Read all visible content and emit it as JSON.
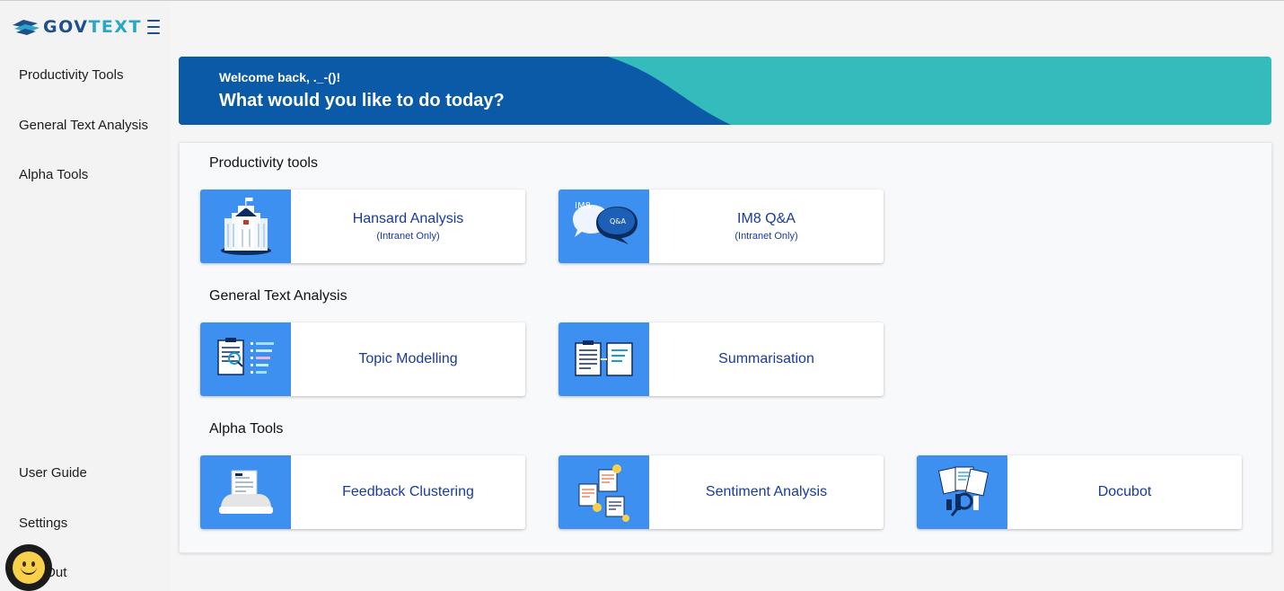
{
  "brand": {
    "gov": "GOV",
    "text": "TEXT"
  },
  "sidebar": {
    "top_items": [
      "Productivity Tools",
      "General Text Analysis",
      "Alpha Tools"
    ],
    "bottom_items": [
      "User Guide",
      "Settings",
      "Log Out"
    ]
  },
  "banner": {
    "welcome": "Welcome back, ._-()!",
    "question": "What would you like to do today?",
    "colors": {
      "left": "#0a5aa7",
      "right": "#34bcbd"
    }
  },
  "sections": [
    {
      "title": "Productivity tools",
      "cards": [
        {
          "title": "Hansard Analysis",
          "sub": "(Intranet Only)",
          "icon": "parliament-building-icon"
        },
        {
          "title": "IM8 Q&A",
          "sub": "(Intranet Only)",
          "icon": "chat-bubbles-icon",
          "icon_text_1": "IM8",
          "icon_text_2": "Q&A"
        }
      ]
    },
    {
      "title": "General Text Analysis",
      "cards": [
        {
          "title": "Topic Modelling",
          "icon": "document-topics-icon"
        },
        {
          "title": "Summarisation",
          "icon": "document-summary-icon"
        }
      ]
    },
    {
      "title": "Alpha Tools",
      "cards": [
        {
          "title": "Feedback Clustering",
          "icon": "feedback-printer-icon"
        },
        {
          "title": "Sentiment Analysis",
          "icon": "sentiment-documents-icon"
        },
        {
          "title": "Docubot",
          "icon": "docubot-search-icon"
        }
      ]
    }
  ],
  "accent_color": "#3d8ff0",
  "link_color": "#1a3a9e"
}
